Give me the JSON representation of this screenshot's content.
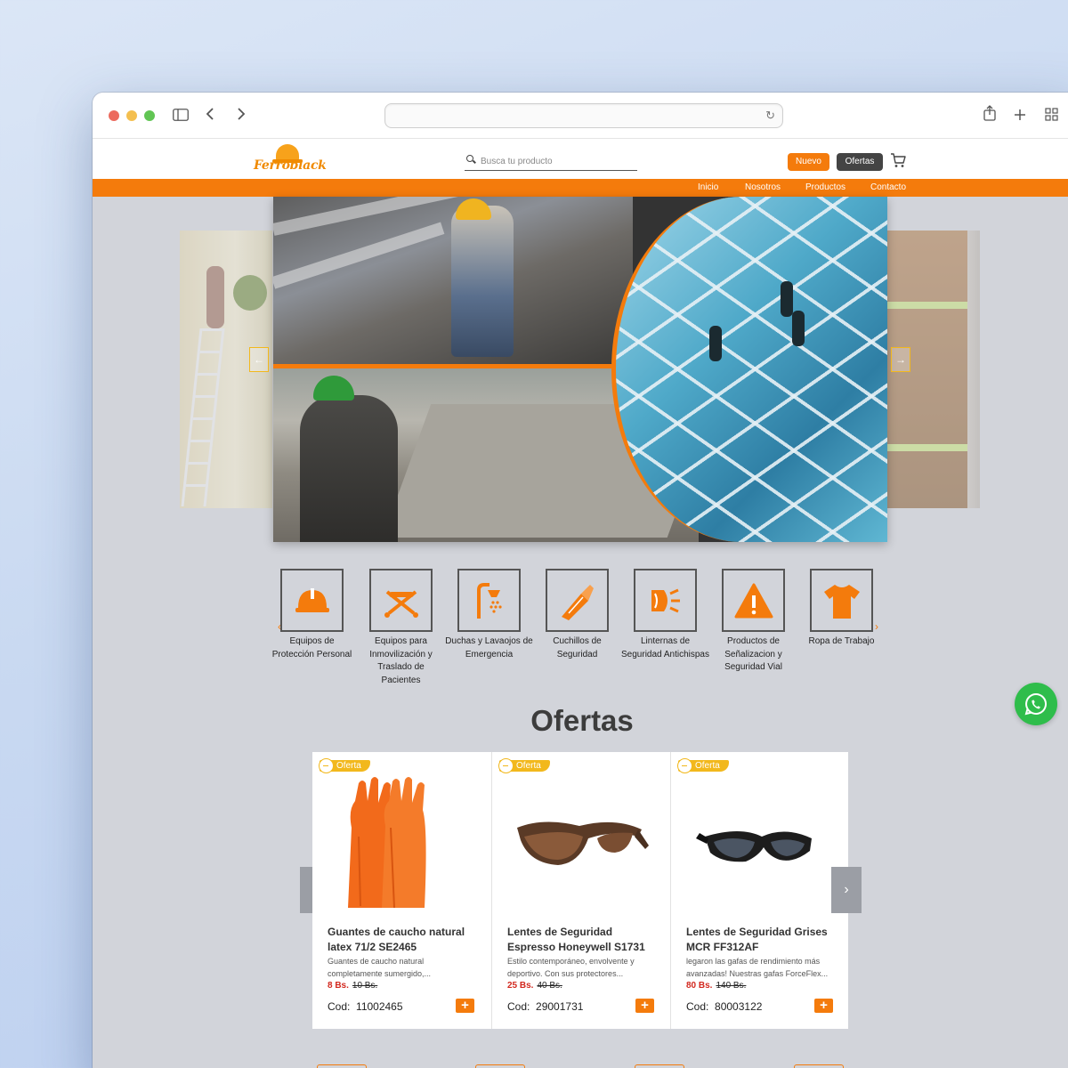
{
  "browser": {
    "url": "",
    "icons": [
      "sidebar-icon",
      "back-icon",
      "forward-icon",
      "reload-icon",
      "share-icon",
      "new-tab-icon",
      "tab-overview-icon"
    ]
  },
  "header": {
    "logo_text": "Ferroblack",
    "search_placeholder": "Busca tu producto",
    "btn_nuevo": "Nuevo",
    "btn_ofertas": "Ofertas"
  },
  "nav": {
    "items": [
      "Inicio",
      "Nosotros",
      "Productos",
      "Contacto"
    ]
  },
  "hero": {
    "prev_arrow": "←",
    "next_arrow": "→"
  },
  "categories": [
    {
      "label": "Equipos de Protección Personal",
      "icon": "helmet-icon"
    },
    {
      "label": "Equipos para Inmovilización y Traslado de Pacientes",
      "icon": "stretcher-icon"
    },
    {
      "label": "Duchas y Lavaojos de Emergencia",
      "icon": "shower-icon"
    },
    {
      "label": "Cuchillos de Seguridad",
      "icon": "cutter-icon"
    },
    {
      "label": "Linternas de Seguridad Antichispas",
      "icon": "flashlight-icon"
    },
    {
      "label": "Productos de Señalizacion y Seguridad Vial",
      "icon": "warning-icon"
    },
    {
      "label": "Ropa de Trabajo",
      "icon": "shirt-icon"
    }
  ],
  "ofertas": {
    "title": "Ofertas",
    "badge": "Oferta",
    "code_label": "Cod:",
    "products": [
      {
        "name": "Guantes de caucho natural latex 71/2 SE2465",
        "desc": "Guantes de caucho natural completamente sumergido,...",
        "price": "8 Bs.",
        "old_price": "10 Bs.",
        "code": "11002465"
      },
      {
        "name": "Lentes de Seguridad Espresso Honeywell S1731",
        "desc": "Estilo contemporáneo, envolvente y deportivo. Con sus protectores...",
        "price": "25 Bs.",
        "old_price": "40 Bs.",
        "code": "29001731"
      },
      {
        "name": "Lentes de Seguridad Grises MCR FF312AF",
        "desc": "legaron las gafas de rendimiento más avanzadas! Nuestras gafas ForceFlex...",
        "price": "80 Bs.",
        "old_price": "140 Bs.",
        "code": "80003122"
      }
    ]
  },
  "colors": {
    "accent": "#f47b0c",
    "badge": "#f2b81c",
    "sale_price": "#d2281e",
    "whatsapp": "#2fbd4b"
  }
}
